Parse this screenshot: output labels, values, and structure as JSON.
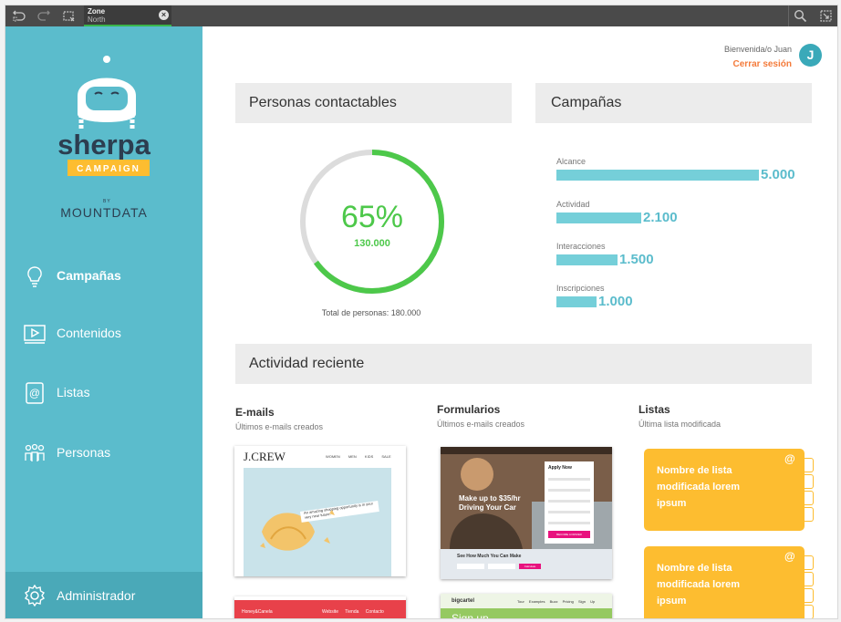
{
  "toolbar": {
    "tab_title": "Zone",
    "tab_subtitle": "North",
    "close_glyph": "×",
    "icons": [
      "undo-icon",
      "redo-icon",
      "fullscreen-icon",
      "search-icon",
      "expand-icon"
    ]
  },
  "sidebar": {
    "logo_text": "sherpa",
    "logo_badge": "CAMPAIGN",
    "mount_prefix": "MOUN",
    "mount_by": "BY",
    "mount_suffix": "TDATA",
    "items": [
      {
        "label": "Campañas",
        "icon": "lightbulb-icon"
      },
      {
        "label": "Contenidos",
        "icon": "video-icon"
      },
      {
        "label": "Listas",
        "icon": "contact-book-icon"
      },
      {
        "label": "Personas",
        "icon": "people-icon"
      }
    ],
    "admin": {
      "label": "Administrador",
      "icon": "gear-icon"
    }
  },
  "header": {
    "greeting": "Bienvenida/o Juan",
    "logout": "Cerrar sesión",
    "avatar_initial": "J"
  },
  "contacts": {
    "title": "Personas contactables",
    "percent_text": "65%",
    "percent": 0.65,
    "count": "130.000",
    "total": "Total de personas: 180.000"
  },
  "campaigns": {
    "title": "Campañas",
    "bars": [
      {
        "label": "Alcance",
        "value": 5000,
        "value_text": "5.000"
      },
      {
        "label": "Actividad",
        "value": 2100,
        "value_text": "2.100"
      },
      {
        "label": "Interacciones",
        "value": 1500,
        "value_text": "1.500"
      },
      {
        "label": "Inscripciones",
        "value": 1000,
        "value_text": "1.000"
      }
    ]
  },
  "activity": {
    "title": "Actividad reciente",
    "emails": {
      "title": "E-mails",
      "subtitle": "Últimos e-mails creados"
    },
    "forms": {
      "title": "Formularios",
      "subtitle": "Últimos e-mails creados"
    },
    "lists": {
      "title": "Listas",
      "subtitle": "Última lista modificada"
    },
    "email_thumb_1": {
      "brand": "J.CREW",
      "nav": [
        "WOMEN",
        "MEN",
        "KIDS",
        "SALE"
      ],
      "fortune": "An amazing shopping opportunity is in your very near future."
    },
    "email_thumb_2": {
      "brand": "Honey&Canela",
      "nav": [
        "Website",
        "Tienda",
        "Contacto"
      ]
    },
    "form_thumb_1": {
      "headline": "Make up to $35/hr Driving Your Car",
      "form_title": "Apply Now",
      "cta": "BECOME A DRIVER",
      "footer": "See How Much You Can Make",
      "footer_btn": "Calculate"
    },
    "form_thumb_2": {
      "brand": "bigcartel",
      "nav": [
        "Tour",
        "Examples",
        "Buzz",
        "Pricing",
        "Sign Up"
      ],
      "headline": "Sign up"
    },
    "list_cards": [
      {
        "text": "Nombre de lista modificada lorem ipsum"
      },
      {
        "text": "Nombre de lista modificada lorem ipsum"
      }
    ]
  },
  "colors": {
    "sidebar": "#5bbccc",
    "accent_green": "#4dc84a",
    "bar": "#75cfd9",
    "list_card": "#fdbd30",
    "logout": "#f47b3b"
  }
}
